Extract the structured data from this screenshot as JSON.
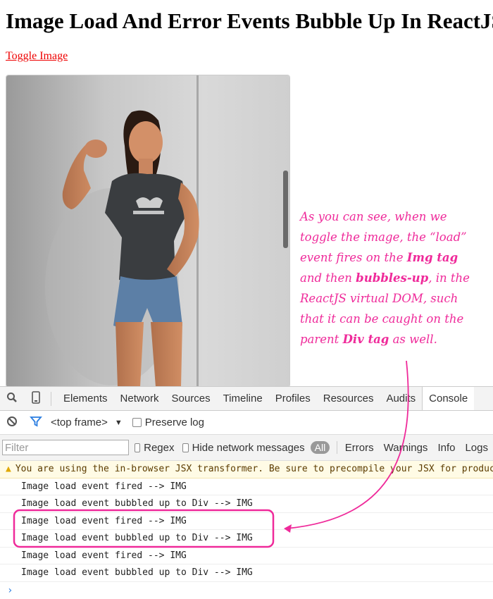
{
  "page": {
    "title": "Image Load And Error Events Bubble Up In ReactJS",
    "toggle_link": "Toggle Image"
  },
  "annotation": {
    "lines": [
      "As you can see, when we",
      "toggle the image, the “load”",
      "event fires on the Img tag",
      "and then bubbles-up, in the",
      "ReactJS virtual DOM, such",
      "that it can be caught on the",
      "parent Div tag as well."
    ],
    "accent_color": "#ef2a9a"
  },
  "devtools": {
    "tabs": [
      "Elements",
      "Network",
      "Sources",
      "Timeline",
      "Profiles",
      "Resources",
      "Audits",
      "Console"
    ],
    "active_tab": "Console",
    "frame_select": "<top frame>",
    "preserve_log": "Preserve log",
    "filter_placeholder": "Filter",
    "regex": "Regex",
    "hide_network": "Hide network messages",
    "levels": [
      "All",
      "Errors",
      "Warnings",
      "Info",
      "Logs"
    ],
    "console": {
      "warning": "You are using the in-browser JSX transformer. Be sure to precompile your JSX for production",
      "lines": [
        "Image load event fired --> IMG",
        "Image load event bubbled up to Div --> IMG",
        "Image load event fired --> IMG",
        "Image load event bubbled up to Div --> IMG",
        "Image load event fired --> IMG",
        "Image load event bubbled up to Div --> IMG"
      ],
      "prompt": "›"
    },
    "icons": [
      "search-icon",
      "device-mode-icon",
      "clear-console-icon",
      "filter-icon",
      "warning-icon",
      "prompt-icon"
    ]
  }
}
